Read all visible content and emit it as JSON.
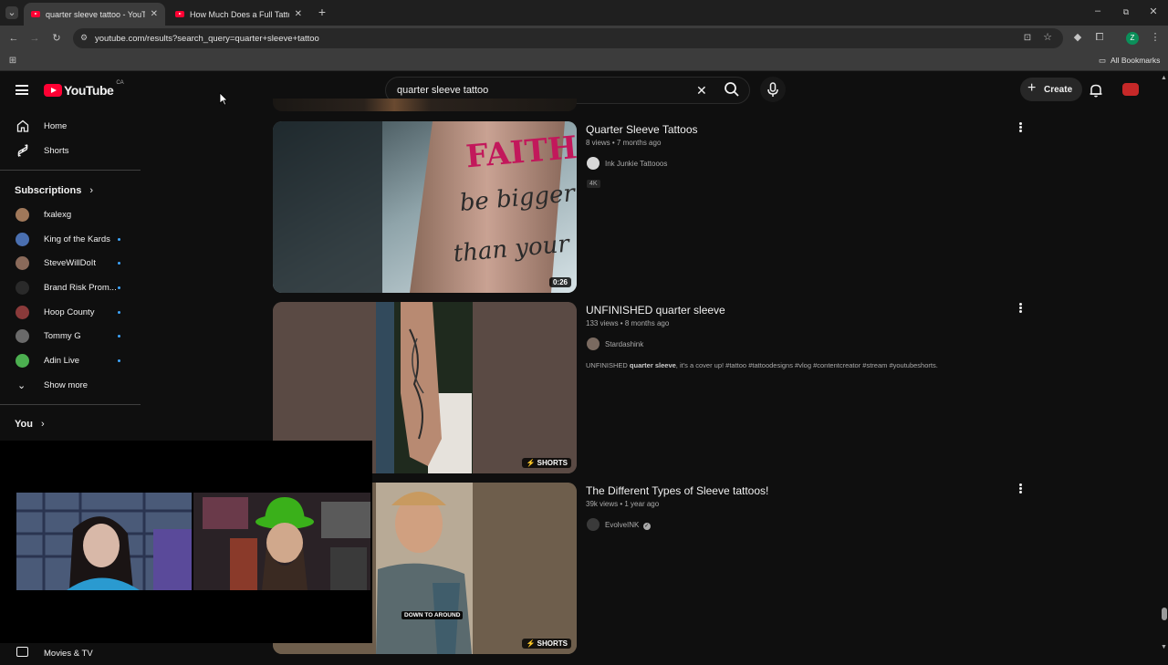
{
  "browser": {
    "tabs": [
      {
        "title": "quarter sleeve tattoo - YouTube",
        "active": true
      },
      {
        "title": "How Much Does a Full Tattoo S",
        "active": false
      }
    ],
    "url": "youtube.com/results?search_query=quarter+sleeve+tattoo",
    "all_bookmarks": "All Bookmarks",
    "profile_initial": "Z"
  },
  "header": {
    "logo_text": "YouTube",
    "logo_country": "CA",
    "search_value": "quarter sleeve tattoo",
    "create_label": "Create",
    "accent_color": "#ff0033"
  },
  "sidebar": {
    "main": [
      {
        "label": "Home",
        "icon": "home-icon"
      },
      {
        "label": "Shorts",
        "icon": "shorts-icon"
      }
    ],
    "subscriptions_title": "Subscriptions",
    "subscriptions": [
      {
        "label": "fxalexg",
        "new": false,
        "color": "#a0785a"
      },
      {
        "label": "King of the Kards",
        "new": true,
        "color": "#4a6fb0"
      },
      {
        "label": "SteveWillDoIt",
        "new": true,
        "color": "#8a6a5a"
      },
      {
        "label": "Brand Risk Prom...",
        "new": true,
        "color": "#2a2a2a"
      },
      {
        "label": "Hoop County",
        "new": true,
        "color": "#8a3a3a"
      },
      {
        "label": "Tommy G",
        "new": true,
        "color": "#6a6a6a"
      },
      {
        "label": "Adin Live",
        "new": true,
        "color": "#4caf50"
      }
    ],
    "show_more": "Show more",
    "you_title": "You",
    "movies_tv": "Movies & TV"
  },
  "results": [
    {
      "title": "Quarter Sleeve Tattoos",
      "meta": "8 views • 7 months ago",
      "channel": "Ink Junkie Tattooos",
      "tag": "4K",
      "duration": "0:26"
    },
    {
      "title": "UNFINISHED quarter sleeve",
      "meta": "133 views • 8 months ago",
      "channel": "Stardashink",
      "desc_pre": "UNFINISHED ",
      "desc_bold": "quarter sleeve",
      "desc_post": ", it's a cover up! #tattoo #tattoodesigns #vlog #contentcreator #stream #youtubeshorts.",
      "badge": "SHORTS"
    },
    {
      "title": "The Different Types of Sleeve tattoos!",
      "meta": "39k views • 1 year ago",
      "channel": "EvolveINK",
      "badge": "SHORTS",
      "caption": "DOWN TO AROUND"
    }
  ],
  "thumb1_text": {
    "line1": "FAITH",
    "line2": "be bigger",
    "line3": "than your"
  }
}
